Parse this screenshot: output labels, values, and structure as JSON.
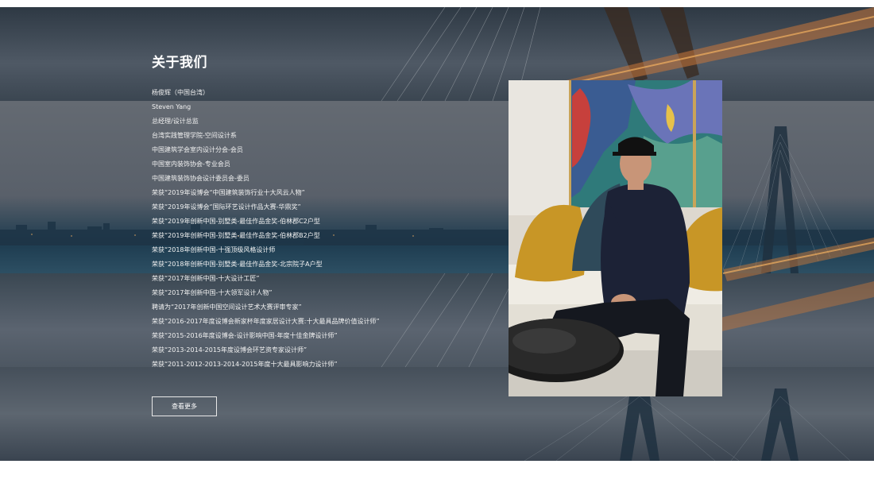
{
  "about": {
    "title": "关于我们",
    "bio_lines": [
      "杨俊辉（中国台湾）",
      "Steven Yang",
      "总经理/设计总监",
      "台湾实践管理学院-空间设计系",
      "中国建筑学会室内设计分会-会员",
      "中国室内装饰协会-专业会员",
      "中国建筑装饰协会设计委员会-委员",
      "荣获“2019年设博会“中国建筑装饰行业十大风云人物”",
      "荣获“2019年设博会“国际环艺设计作品大赛-华鼎奖”",
      "荣获“2019年创新中国-别墅类-最佳作品金奖-伯林郡C2户型",
      "荣获“2019年创新中国-别墅类-最佳作品金奖-伯林郡B2户型",
      "荣获“2018年创新中国-十强顶级风格设计师",
      "荣获“2018年创新中国-别墅类-最佳作品金奖-北宗院子A户型",
      "荣获“2017年创新中国-十大设计工匠”",
      "荣获“2017年创新中国-十大领军设计人物”",
      "聘请为“2017年创新中国空间设计艺术大赛评审专家”",
      "荣获“2016-2017年度设博会新家杯年度家居设计大赛:十大最具品牌价值设计师”",
      "荣获“2015-2016年度设博会-设计影响中国-年度十佳金牌设计师”",
      "荣获“2013-2014-2015年度设博会环艺资专家设计师”",
      "荣获“2011-2012-2013-2014-2015年度十大最具影响力设计师”"
    ],
    "more_label": "查看更多",
    "photo_icon": "person-portrait"
  },
  "colors": {
    "hero_dark": "#2e3944",
    "text": "#ffffff",
    "button_border": "#e8e8e8",
    "bridge_lights": "#e08a3c"
  }
}
